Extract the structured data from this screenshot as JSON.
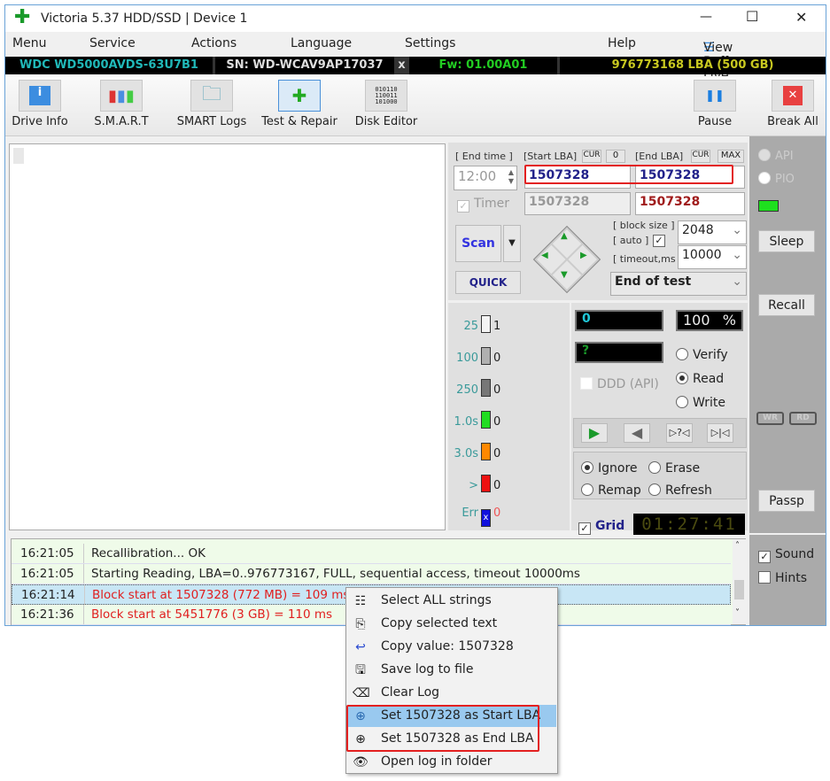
{
  "window": {
    "title": "Victoria 5.37 HDD/SSD | Device 1",
    "minimize": "—",
    "maximize": "☐",
    "close": "✕"
  },
  "menu": [
    "Menu",
    "Service",
    "Actions",
    "Language",
    "Settings",
    "Help"
  ],
  "view_buffer": "View Buffer Live",
  "drive": {
    "model": "WDC WD5000AVDS-63U7B1",
    "serial": "SN: WD-WCAV9AP17037",
    "x": "x",
    "firmware": "Fw: 01.00A01",
    "capacity": "976773168 LBA (500 GB)"
  },
  "toolbar": {
    "drive_info": "Drive Info",
    "smart": "S.M.A.R.T",
    "smart_logs": "SMART Logs",
    "test_repair": "Test & Repair",
    "disk_editor": "Disk Editor",
    "pause": "Pause",
    "break_all": "Break All"
  },
  "test": {
    "end_time_label": "[ End time ]",
    "end_time": "12:00",
    "start_lba_label": "[Start LBA]",
    "cur": "CUR",
    "zero": "0",
    "end_lba_label": "[End LBA]",
    "max": "MAX",
    "start_lba": "1507328",
    "end_lba": "1507328",
    "timer_label": "Timer",
    "current_lba": "1507328",
    "end_lba_current": "1507328",
    "scan": "Scan",
    "quick": "QUICK",
    "block_size_label": "[ block size ]",
    "auto_label": "[ auto ]",
    "timeout_label": "[ timeout,ms ]",
    "block_size": "2048",
    "timeout": "10000",
    "end_action": "End of test"
  },
  "legend": [
    {
      "label": "25",
      "count": "1",
      "color": "#f4f4f4"
    },
    {
      "label": "100",
      "count": "0",
      "color": "#b0b0b0"
    },
    {
      "label": "250",
      "count": "0",
      "color": "#777777"
    },
    {
      "label": "1.0s",
      "count": "0",
      "color": "#22dd22"
    },
    {
      "label": "3.0s",
      "count": "0",
      "color": "#ff8800"
    },
    {
      "label": ">",
      "count": "0",
      "color": "#ee1111"
    },
    {
      "label": "Err",
      "count": "0",
      "color": "#1111dd"
    }
  ],
  "status": {
    "position": "0",
    "percent": "100",
    "percent_sign": "%",
    "speed": "?",
    "ddd": "DDD (API)",
    "verify": "Verify",
    "read": "Read",
    "write": "Write",
    "mode_selected": "Read",
    "ignore": "Ignore",
    "erase": "Erase",
    "remap": "Remap",
    "refresh": "Refresh",
    "repair_selected": "Ignore",
    "grid": "Grid",
    "elapsed": "01:27:41"
  },
  "sidebar": {
    "api": "API",
    "pio": "PIO",
    "sleep": "Sleep",
    "recall": "Recall",
    "wr": "WR",
    "rd": "RD",
    "passp": "Passp",
    "sound": "Sound",
    "hints": "Hints"
  },
  "log": [
    {
      "time": "16:21:05",
      "msg": "Recallibration... OK",
      "color": "#222"
    },
    {
      "time": "16:21:05",
      "msg": "Starting Reading, LBA=0..976773167, FULL, sequential access, timeout 10000ms",
      "color": "#222"
    },
    {
      "time": "16:21:14",
      "msg": "Block start at 1507328 (772 MB)  = 109 ms",
      "color": "#e02020"
    },
    {
      "time": "16:21:36",
      "msg": "Block start at 5451776 (3 GB)  = 110 ms",
      "color": "#e02020"
    }
  ],
  "context_menu": [
    "Select ALL strings",
    "Copy selected text",
    "Copy value: 1507328",
    "Save log to file",
    "Clear Log",
    "Set 1507328 as Start LBA",
    "Set 1507328 as End LBA",
    "Open log in folder"
  ],
  "colors": {
    "accent_green": "#1a9a2a",
    "highlight": "#e32020",
    "selection": "#99c9ef"
  }
}
